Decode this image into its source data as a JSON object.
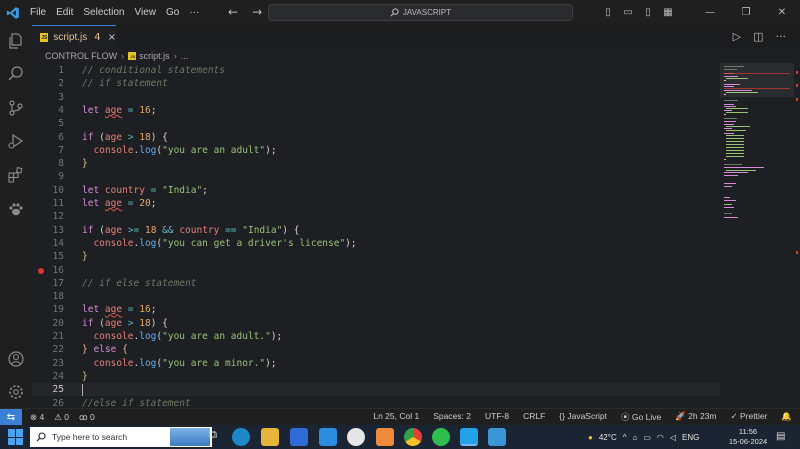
{
  "titlebar": {
    "menu": [
      "File",
      "Edit",
      "Selection",
      "View",
      "Go",
      "···"
    ],
    "back": "←",
    "forward": "→",
    "search_text": "JAVASCRIPT"
  },
  "tab": {
    "badge": "JS",
    "name": "script.js",
    "problems": "4",
    "close": "×"
  },
  "breadcrumb": {
    "folder": "CONTROL FLOW",
    "file": "script.js",
    "more": "..."
  },
  "editor": {
    "current_line": 25,
    "breakpoint_line": 16,
    "lines": [
      {
        "n": "1"
      },
      {
        "n": "2"
      },
      {
        "n": "3"
      },
      {
        "n": "4"
      },
      {
        "n": "5"
      },
      {
        "n": "6"
      },
      {
        "n": "7"
      },
      {
        "n": "8"
      },
      {
        "n": "9"
      },
      {
        "n": "10"
      },
      {
        "n": "11"
      },
      {
        "n": "12"
      },
      {
        "n": "13"
      },
      {
        "n": "14"
      },
      {
        "n": "15"
      },
      {
        "n": "16"
      },
      {
        "n": "17"
      },
      {
        "n": "18"
      },
      {
        "n": "19"
      },
      {
        "n": "20"
      },
      {
        "n": "21"
      },
      {
        "n": "22"
      },
      {
        "n": "23"
      },
      {
        "n": "24"
      },
      {
        "n": "25"
      },
      {
        "n": "26"
      }
    ],
    "tokens": {
      "l1": "// conditional statements",
      "l2": "// if statement",
      "l4_kw": "let",
      "l4_var": "age",
      "l4_eq": " = ",
      "l4_num": "16",
      "l4_end": ";",
      "l6_kw": "if",
      "l6_p": " (",
      "l6_var": "age",
      "l6_op": " > ",
      "l6_num": "18",
      "l6_end": ") {",
      "l7_obj": "console",
      "l7_dot": ".",
      "l7_fn": "log",
      "l7_p1": "(",
      "l7_str": "\"you are an adult\"",
      "l7_p2": ");",
      "l8": "}",
      "l10_kw": "let",
      "l10_var": "country",
      "l10_eq": " = ",
      "l10_str": "\"India\"",
      "l10_end": ";",
      "l11_kw": "let",
      "l11_var": "age",
      "l11_eq": " = ",
      "l11_num": "20",
      "l11_end": ";",
      "l13_kw": "if",
      "l13_p": " (",
      "l13_var1": "age",
      "l13_op1": " >= ",
      "l13_num": "18",
      "l13_op2": " && ",
      "l13_var2": "country",
      "l13_op3": " == ",
      "l13_str": "\"India\"",
      "l13_end": ") {",
      "l14_obj": "console",
      "l14_dot": ".",
      "l14_fn": "log",
      "l14_p1": "(",
      "l14_str": "\"you can get a driver's license\"",
      "l14_p2": ");",
      "l15": "}",
      "l17": "// if else statement",
      "l19_kw": "let",
      "l19_var": "age",
      "l19_eq": " = ",
      "l19_num": "16",
      "l19_end": ";",
      "l20_kw": "if",
      "l20_p": " (",
      "l20_var": "age",
      "l20_op": " > ",
      "l20_num": "18",
      "l20_end": ") {",
      "l21_obj": "console",
      "l21_dot": ".",
      "l21_fn": "log",
      "l21_p1": "(",
      "l21_str": "\"you are an adult.\"",
      "l21_p2": ");",
      "l22_b": "} ",
      "l22_kw": "else",
      "l22_end": " {",
      "l23_obj": "console",
      "l23_dot": ".",
      "l23_fn": "log",
      "l23_p1": "(",
      "l23_str": "\"you are a minor.\"",
      "l23_p2": ");",
      "l24": "}",
      "l26": "//else if statement"
    }
  },
  "statusbar": {
    "remote_icon": "remote-icon",
    "errors": "⊗ 4",
    "warnings": "⚠ 0",
    "ports": "ꝏ 0",
    "position": "Ln 25, Col 1",
    "spaces": "Spaces: 2",
    "encoding": "UTF-8",
    "eol": "CRLF",
    "language": "{} JavaScript",
    "golive": "⦿ Go Live",
    "time_spent": "2h 23m",
    "prettier": "✓ Prettier",
    "bell": "🔔"
  },
  "taskbar": {
    "search_placeholder": "Type here to search",
    "weather": "42°C",
    "lang": "ENG",
    "time": "11:56",
    "date": "15-06-2024"
  },
  "colors": {
    "accent": "#3b7fd6",
    "editor_bg": "#1e1f22",
    "keyword": "#d38dd6",
    "string": "#98c379",
    "number": "#e5a86a",
    "comment": "#6a7a66",
    "variable": "#e5807a",
    "breakpoint": "#d93636"
  }
}
